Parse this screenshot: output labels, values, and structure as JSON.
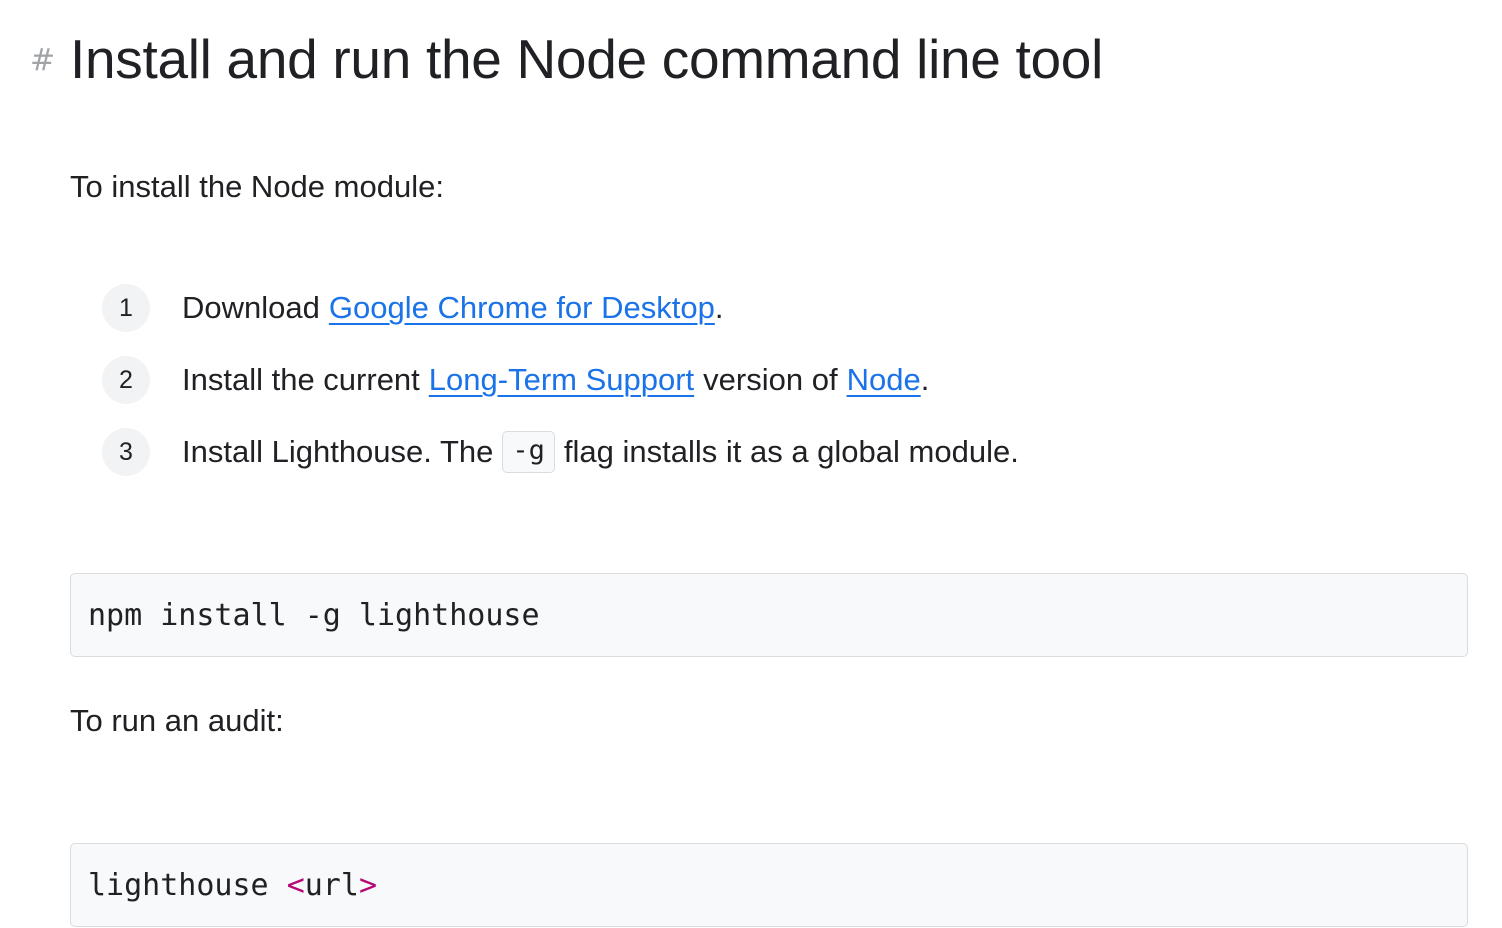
{
  "heading": {
    "anchor_symbol": "#",
    "title": "Install and run the Node command line tool"
  },
  "intro_text": "To install the Node module:",
  "steps": [
    {
      "number": "1",
      "text_before": "Download",
      "link": "Google Chrome for Desktop",
      "text_after": "."
    },
    {
      "number": "2",
      "text_before": "Install the current",
      "link": "Long-Term Support",
      "text_middle": "version of",
      "link2": "Node",
      "text_after": "."
    },
    {
      "number": "3",
      "text_before": "Install Lighthouse. The",
      "code": "-g",
      "text_after": "flag installs it as a global module."
    }
  ],
  "install_code": "npm install -g lighthouse",
  "run_text": "To run an audit:",
  "audit_code": {
    "command": "lighthouse ",
    "open_bracket": "<",
    "argument": "url",
    "close_bracket": ">"
  },
  "colors": {
    "link": "#1a73e8",
    "code_tag": "#b80672",
    "code_background": "#f8f9fa",
    "step_circle": "#f1f3f4"
  }
}
